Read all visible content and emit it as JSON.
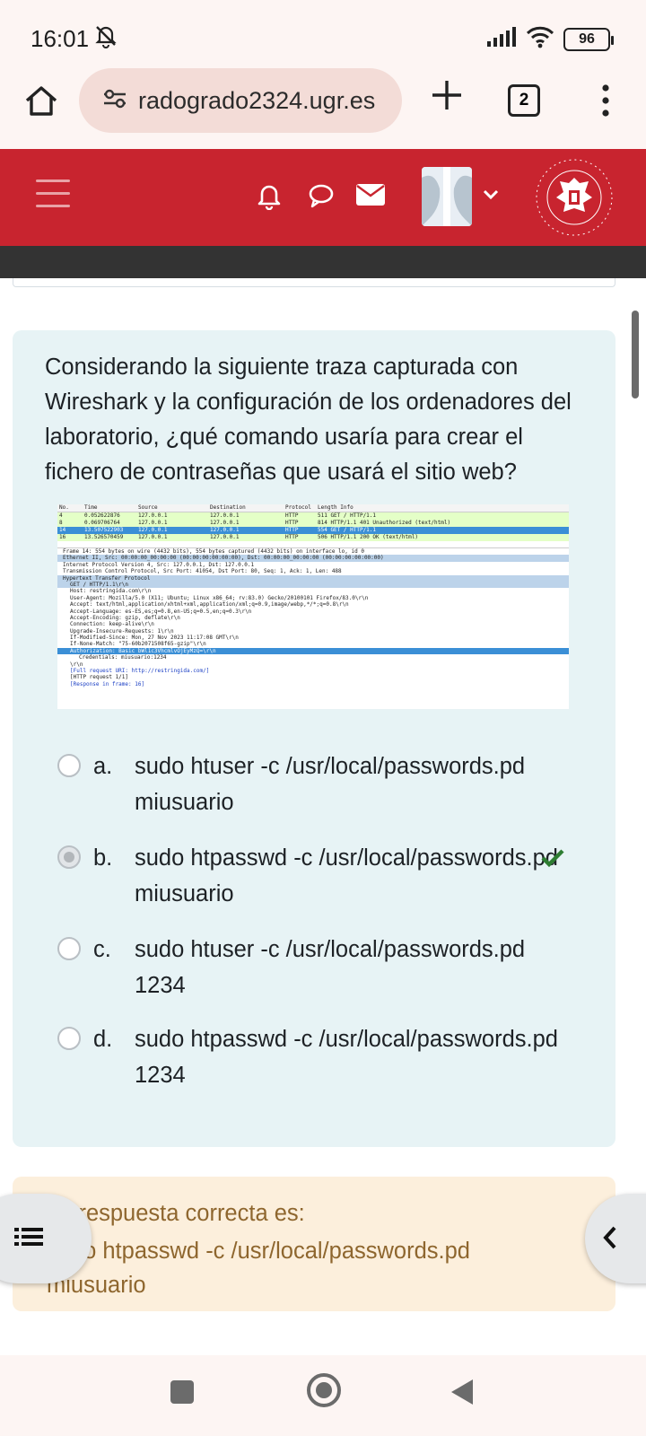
{
  "status_bar": {
    "time": "16:01",
    "battery": "96"
  },
  "browser": {
    "url": "radogrado2324.ugr.es",
    "tab_count": "2"
  },
  "question": {
    "text": "Considerando la siguiente traza capturada con Wireshark y la configuración de los ordenadores del laboratorio, ¿qué comando usaría para crear el fichero de contraseñas que usará el sitio web?",
    "options": [
      {
        "letter": "a.",
        "text": "sudo htuser -c /usr/local/passwords.pd miusuario",
        "selected": false
      },
      {
        "letter": "b.",
        "text": "sudo htpasswd -c /usr/local/passwords.pd miusuario",
        "selected": true
      },
      {
        "letter": "c.",
        "text": "sudo htuser -c /usr/local/passwords.pd 1234",
        "selected": false
      },
      {
        "letter": "d.",
        "text": "sudo htpasswd -c /usr/local/passwords.pd 1234",
        "selected": false
      }
    ]
  },
  "wireshark": {
    "headers": [
      "No.",
      "Time",
      "Source",
      "Destination",
      "Protocol",
      "Length Info"
    ],
    "packets": [
      [
        "4",
        "0.052622876",
        "127.0.0.1",
        "127.0.0.1",
        "HTTP",
        "511 GET / HTTP/1.1"
      ],
      [
        "8",
        "0.069706764",
        "127.0.0.1",
        "127.0.0.1",
        "HTTP",
        "814 HTTP/1.1 401 Unauthorized  (text/html)"
      ],
      [
        "14",
        "13.507522903",
        "127.0.0.1",
        "127.0.0.1",
        "HTTP",
        "554 GET / HTTP/1.1"
      ],
      [
        "16",
        "13.526570459",
        "127.0.0.1",
        "127.0.0.1",
        "HTTP",
        "506 HTTP/1.1 200 OK  (text/html)"
      ]
    ],
    "details": [
      "Frame 14: 554 bytes on wire (4432 bits), 554 bytes captured (4432 bits) on interface lo, id 0",
      "Ethernet II, Src: 00:00:00_00:00:00 (00:00:00:00:00:00), Dst: 00:00:00_00:00:00 (00:00:00:00:00:00)",
      "Internet Protocol Version 4, Src: 127.0.0.1, Dst: 127.0.0.1",
      "Transmission Control Protocol, Src Port: 41054, Dst Port: 80, Seq: 1, Ack: 1, Len: 488",
      "Hypertext Transfer Protocol",
      "GET / HTTP/1.1\\r\\n",
      "Host: restringida.com\\r\\n",
      "User-Agent: Mozilla/5.0 (X11; Ubuntu; Linux x86_64; rv:83.0) Gecko/20100101 Firefox/83.0\\r\\n",
      "Accept: text/html,application/xhtml+xml,application/xml;q=0.9,image/webp,*/*;q=0.8\\r\\n",
      "Accept-Language: es-ES,es;q=0.8,en-US;q=0.5,en;q=0.3\\r\\n",
      "Accept-Encoding: gzip, deflate\\r\\n",
      "Connection: keep-alive\\r\\n",
      "Upgrade-Insecure-Requests: 1\\r\\n",
      "If-Modified-Since: Mon, 27 Nov 2023 11:17:08 GMT\\r\\n",
      "If-None-Match: \"75-60b2071508f65-gzip\"\\r\\n",
      "Authorization: Basic bWl1c3VhcmlvOjEyMzQ=\\r\\n",
      "Credentials: miusuario:1234",
      "\\r\\n",
      "[Full request URI: http://restringida.com/]",
      "[HTTP request 1/1]",
      "[Response in frame: 16]"
    ]
  },
  "feedback": {
    "label": "La respuesta correcta es:",
    "answer": "sudo htpasswd -c /usr/local/passwords.pd miusuario"
  },
  "colors": {
    "brand_red": "#c8242f",
    "question_bg": "#e7f3f5",
    "feedback_bg": "#fcefdc",
    "correct_green": "#2e7d32"
  }
}
